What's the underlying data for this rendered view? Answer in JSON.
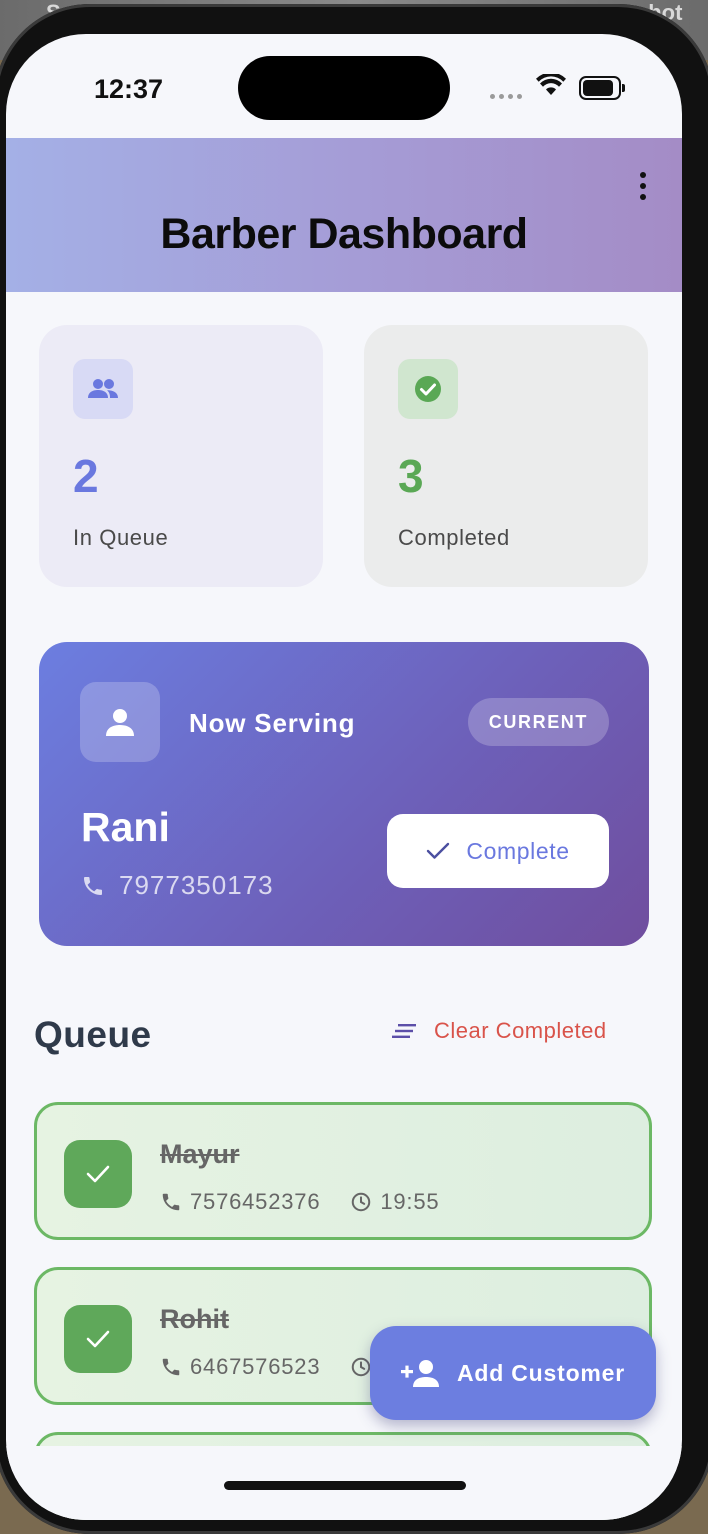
{
  "status_bar": {
    "time": "12:37"
  },
  "header": {
    "title": "Barber Dashboard"
  },
  "stats": [
    {
      "value": "2",
      "label": "In Queue",
      "icon": "people-icon"
    },
    {
      "value": "3",
      "label": "Completed",
      "icon": "check-circle-icon"
    }
  ],
  "now_serving": {
    "heading": "Now Serving",
    "badge": "CURRENT",
    "name": "Rani",
    "phone": "7977350173",
    "complete_label": "Complete"
  },
  "queue": {
    "title": "Queue",
    "clear_label": "Clear Completed",
    "items": [
      {
        "name": "Mayur",
        "phone": "7576452376",
        "time": "19:55",
        "status": "completed"
      },
      {
        "name": "Rohit",
        "phone": "6467576523",
        "time": "",
        "status": "completed"
      }
    ]
  },
  "fab": {
    "label": "Add Customer"
  },
  "colors": {
    "accent": "#6c7ee0",
    "success": "#5fa85a",
    "danger": "#d9534a",
    "header_gradient_start": "#a4b0e6",
    "header_gradient_end": "#a48cc6"
  }
}
